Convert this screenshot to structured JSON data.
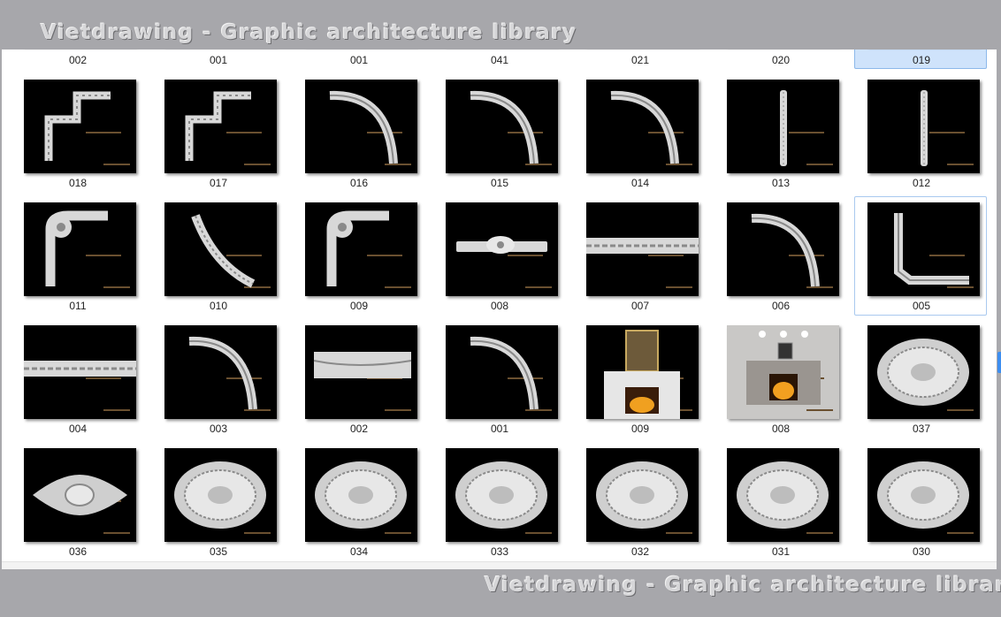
{
  "watermark": {
    "top": "Vietdrawing - Graphic architecture library",
    "bottom": "Vietdrawing - Graphic architecture library"
  },
  "rows": [
    {
      "items": [
        {
          "label": "002",
          "icon": "thumbnail-cut-off"
        },
        {
          "label": "001",
          "icon": "thumbnail-cut-off"
        },
        {
          "label": "001",
          "icon": "thumbnail-cut-off"
        },
        {
          "label": "041",
          "icon": "thumbnail-cut-off"
        },
        {
          "label": "021",
          "icon": "thumbnail-cut-off"
        },
        {
          "label": "020",
          "icon": "thumbnail-cut-off"
        },
        {
          "label": "019",
          "icon": "thumbnail-cut-off",
          "selected": true
        }
      ]
    },
    {
      "items": [
        {
          "label": "018",
          "icon": "zigzag-molding-corner"
        },
        {
          "label": "017",
          "icon": "zigzag-molding-corner"
        },
        {
          "label": "016",
          "icon": "curved-molding-corner"
        },
        {
          "label": "015",
          "icon": "curved-molding-corner"
        },
        {
          "label": "014",
          "icon": "curved-molding-corner"
        },
        {
          "label": "013",
          "icon": "vertical-molding-strip"
        },
        {
          "label": "012",
          "icon": "vertical-molding-strip"
        }
      ]
    },
    {
      "items": [
        {
          "label": "011",
          "icon": "ornate-molding-corner"
        },
        {
          "label": "010",
          "icon": "arched-molding"
        },
        {
          "label": "009",
          "icon": "ornate-molding-corner"
        },
        {
          "label": "008",
          "icon": "floral-molding-strip"
        },
        {
          "label": "007",
          "icon": "horizontal-molding-strip"
        },
        {
          "label": "006",
          "icon": "curved-molding-corner"
        },
        {
          "label": "005",
          "icon": "l-shaped-molding",
          "focused": true
        }
      ]
    },
    {
      "items": [
        {
          "label": "004",
          "icon": "horizontal-molding-strip"
        },
        {
          "label": "003",
          "icon": "curved-molding-corner"
        },
        {
          "label": "002",
          "icon": "crown-molding-profile"
        },
        {
          "label": "001",
          "icon": "curved-molding-corner"
        },
        {
          "label": "009",
          "icon": "fireplace-with-painting"
        },
        {
          "label": "008",
          "icon": "fireplace-with-lights"
        },
        {
          "label": "037",
          "icon": "ceiling-medallion"
        }
      ]
    },
    {
      "items": [
        {
          "label": "036",
          "icon": "ornamental-applique"
        },
        {
          "label": "035",
          "icon": "ceiling-medallion"
        },
        {
          "label": "034",
          "icon": "ceiling-medallion"
        },
        {
          "label": "033",
          "icon": "ceiling-medallion"
        },
        {
          "label": "032",
          "icon": "ceiling-medallion"
        },
        {
          "label": "031",
          "icon": "ceiling-medallion"
        },
        {
          "label": "030",
          "icon": "ceiling-medallion"
        }
      ]
    }
  ]
}
